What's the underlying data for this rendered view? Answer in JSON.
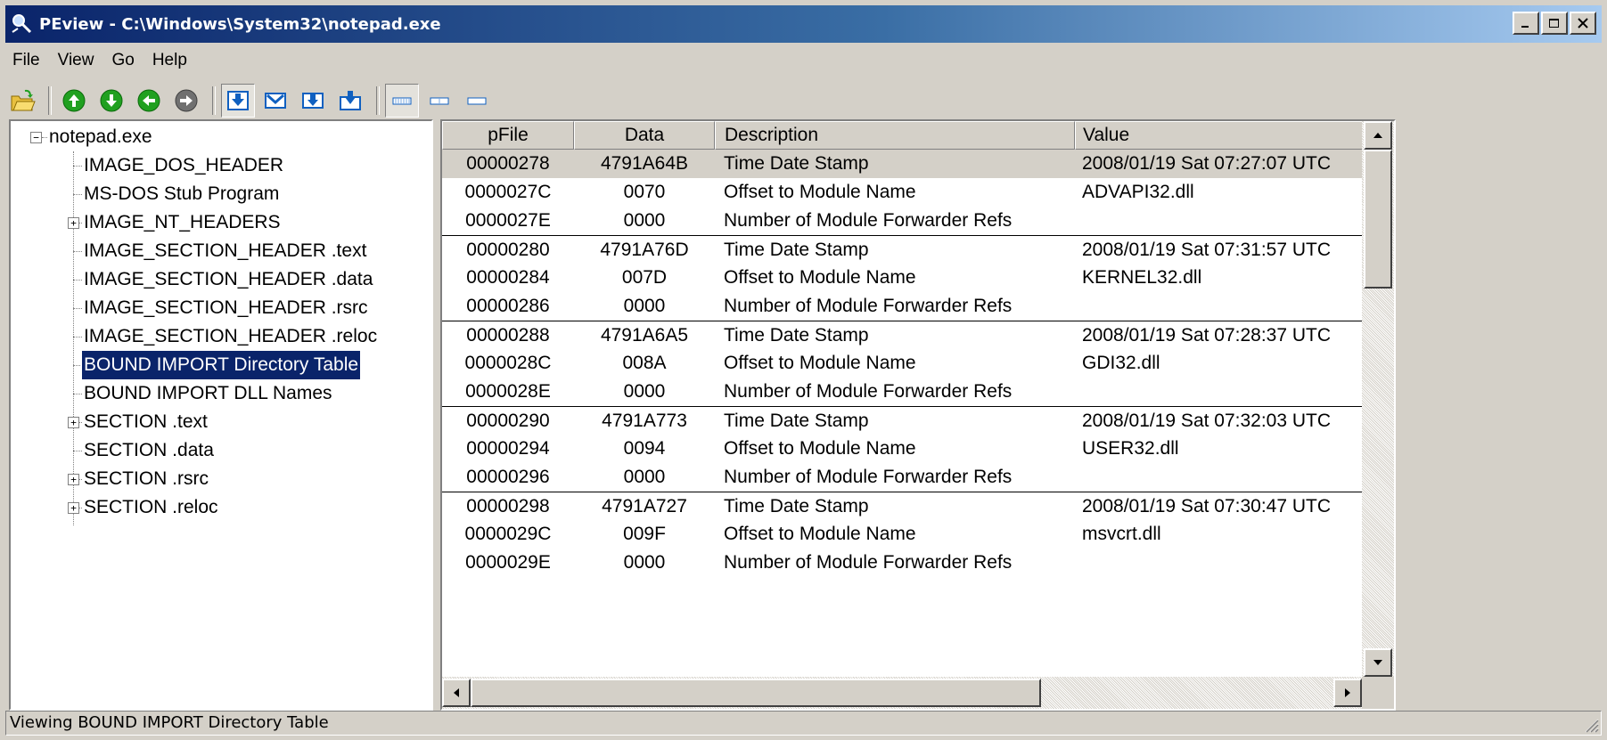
{
  "window": {
    "title": "PEview - C:\\Windows\\System32\\notepad.exe",
    "buttons": [
      "_",
      "□",
      "×"
    ]
  },
  "menu": [
    "File",
    "View",
    "Go",
    "Help"
  ],
  "toolbar": {
    "icons": [
      "open-folder-icon",
      "up-arrow-icon",
      "down-arrow-icon",
      "back-arrow-icon",
      "forward-arrow-icon",
      "view-byte-icon",
      "view-word-icon",
      "view-dword-icon",
      "view-details-icon",
      "view-large-icon",
      "view-medium-icon",
      "view-small-icon"
    ]
  },
  "tree": {
    "root": "notepad.exe",
    "items": [
      {
        "label": "IMAGE_DOS_HEADER",
        "expandable": false
      },
      {
        "label": "MS-DOS Stub Program",
        "expandable": false
      },
      {
        "label": "IMAGE_NT_HEADERS",
        "expandable": true
      },
      {
        "label": "IMAGE_SECTION_HEADER .text",
        "expandable": false
      },
      {
        "label": "IMAGE_SECTION_HEADER .data",
        "expandable": false
      },
      {
        "label": "IMAGE_SECTION_HEADER .rsrc",
        "expandable": false
      },
      {
        "label": "IMAGE_SECTION_HEADER .reloc",
        "expandable": false
      },
      {
        "label": "BOUND IMPORT Directory Table",
        "expandable": false,
        "selected": true
      },
      {
        "label": "BOUND IMPORT DLL Names",
        "expandable": false
      },
      {
        "label": "SECTION .text",
        "expandable": true
      },
      {
        "label": "SECTION .data",
        "expandable": false
      },
      {
        "label": "SECTION .rsrc",
        "expandable": true
      },
      {
        "label": "SECTION .reloc",
        "expandable": true
      }
    ]
  },
  "table": {
    "columns": [
      "pFile",
      "Data",
      "Description",
      "Value"
    ],
    "rows": [
      [
        "00000278",
        "4791A64B",
        "Time Date Stamp",
        "2008/01/19 Sat 07:27:07 UTC"
      ],
      [
        "0000027C",
        "0070",
        "Offset to Module Name",
        "ADVAPI32.dll"
      ],
      [
        "0000027E",
        "0000",
        "Number of Module Forwarder Refs",
        ""
      ],
      [
        "00000280",
        "4791A76D",
        "Time Date Stamp",
        "2008/01/19 Sat 07:31:57 UTC"
      ],
      [
        "00000284",
        "007D",
        "Offset to Module Name",
        "KERNEL32.dll"
      ],
      [
        "00000286",
        "0000",
        "Number of Module Forwarder Refs",
        ""
      ],
      [
        "00000288",
        "4791A6A5",
        "Time Date Stamp",
        "2008/01/19 Sat 07:28:37 UTC"
      ],
      [
        "0000028C",
        "008A",
        "Offset to Module Name",
        "GDI32.dll"
      ],
      [
        "0000028E",
        "0000",
        "Number of Module Forwarder Refs",
        ""
      ],
      [
        "00000290",
        "4791A773",
        "Time Date Stamp",
        "2008/01/19 Sat 07:32:03 UTC"
      ],
      [
        "00000294",
        "0094",
        "Offset to Module Name",
        "USER32.dll"
      ],
      [
        "00000296",
        "0000",
        "Number of Module Forwarder Refs",
        ""
      ],
      [
        "00000298",
        "4791A727",
        "Time Date Stamp",
        "2008/01/19 Sat 07:30:47 UTC"
      ],
      [
        "0000029C",
        "009F",
        "Offset to Module Name",
        "msvcrt.dll"
      ],
      [
        "0000029E",
        "0000",
        "Number of Module Forwarder Refs",
        ""
      ]
    ],
    "highlight_row": 0
  },
  "status": {
    "text": "Viewing BOUND IMPORT Directory Table"
  },
  "colors": {
    "title_start": "#0a246a",
    "title_end": "#a6caf0",
    "selection": "#0a246a",
    "face": "#d4d0c8"
  }
}
